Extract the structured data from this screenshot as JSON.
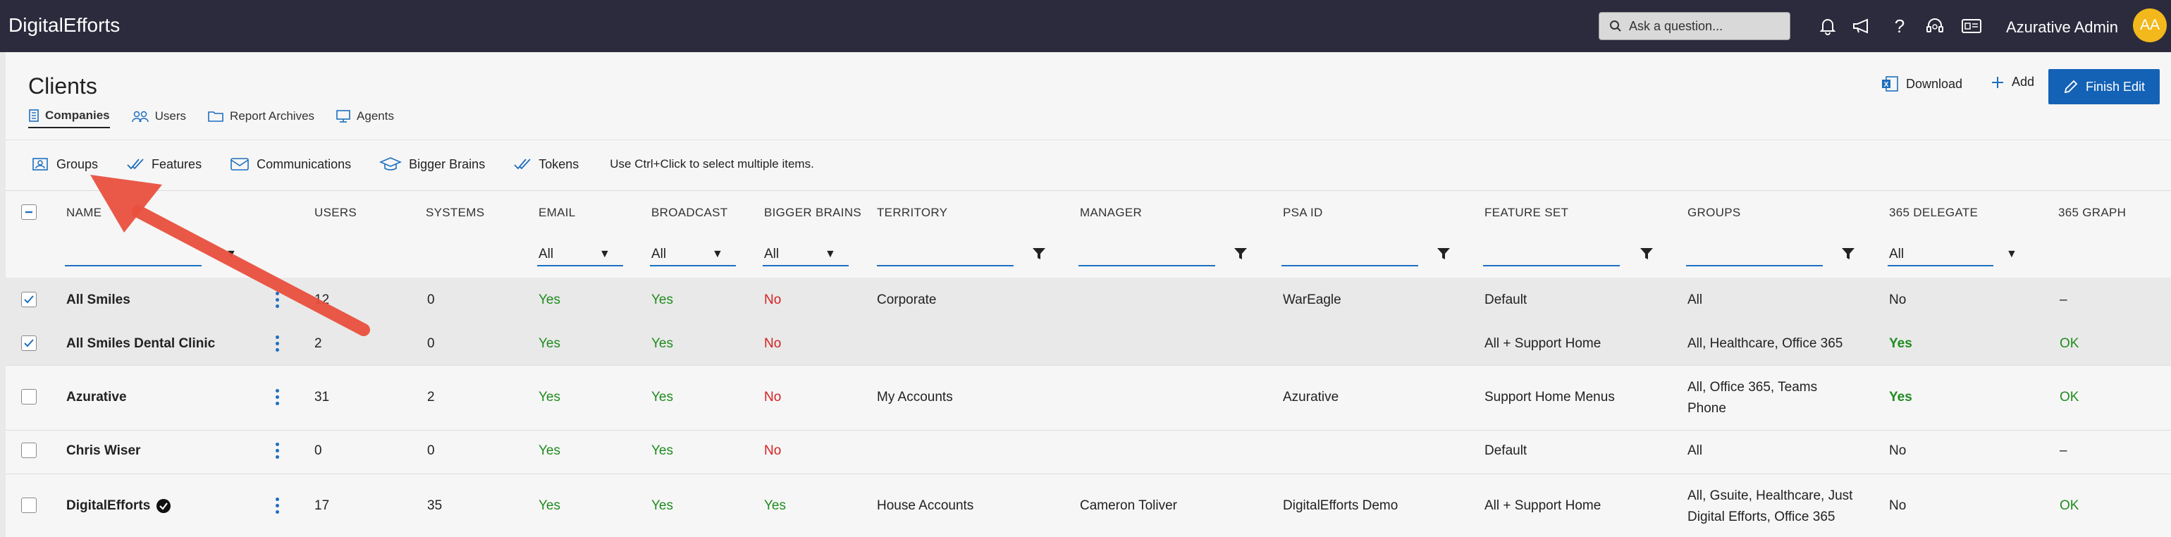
{
  "app": {
    "name": "DigitalEfforts"
  },
  "topbar": {
    "search_placeholder": "Ask a question...",
    "user_name": "Azurative Admin",
    "avatar_initials": "AA",
    "icons": [
      "bell-icon",
      "megaphone-icon",
      "help-icon",
      "headset-icon",
      "id-card-icon"
    ]
  },
  "page": {
    "title": "Clients",
    "subtabs": [
      {
        "label": "Companies",
        "icon": "building-icon",
        "active": true
      },
      {
        "label": "Users",
        "icon": "users-icon",
        "active": false
      },
      {
        "label": "Report Archives",
        "icon": "folder-icon",
        "active": false
      },
      {
        "label": "Agents",
        "icon": "monitor-icon",
        "active": false
      }
    ],
    "actions": {
      "download": "Download",
      "add": "Add",
      "finish_edit": "Finish Edit"
    }
  },
  "toolbar": {
    "items": [
      {
        "label": "Groups",
        "icon": "groups-icon"
      },
      {
        "label": "Features",
        "icon": "double-check-icon"
      },
      {
        "label": "Communications",
        "icon": "envelope-icon"
      },
      {
        "label": "Bigger Brains",
        "icon": "graduation-cap-icon"
      },
      {
        "label": "Tokens",
        "icon": "double-check-icon"
      }
    ],
    "hint": "Use Ctrl+Click to select multiple items."
  },
  "table": {
    "columns": [
      "NAME",
      "USERS",
      "SYSTEMS",
      "EMAIL",
      "BROADCAST",
      "BIGGER BRAINS",
      "TERRITORY",
      "MANAGER",
      "PSA ID",
      "FEATURE SET",
      "GROUPS",
      "365 DELEGATE",
      "365 GRAPH"
    ],
    "filters": {
      "email": "All",
      "broadcast": "All",
      "bigger_brains": "All",
      "delegate": "All"
    },
    "rows": [
      {
        "selected": true,
        "name": "All Smiles",
        "verified": false,
        "users": "12",
        "systems": "0",
        "email": "Yes",
        "broadcast": "Yes",
        "bigger_brains": "No",
        "territory": "Corporate",
        "manager": "",
        "psa_id": "WarEagle",
        "feature_set": "Default",
        "groups": "All",
        "groups2": "",
        "delegate": "No",
        "graph": "–"
      },
      {
        "selected": true,
        "name": "All Smiles Dental Clinic",
        "verified": false,
        "users": "2",
        "systems": "0",
        "email": "Yes",
        "broadcast": "Yes",
        "bigger_brains": "No",
        "territory": "",
        "manager": "",
        "psa_id": "",
        "feature_set": "All + Support Home",
        "groups": "All, Healthcare, Office 365",
        "groups2": "",
        "delegate": "Yes",
        "graph": "OK"
      },
      {
        "selected": false,
        "name": "Azurative",
        "verified": false,
        "users": "31",
        "systems": "2",
        "email": "Yes",
        "broadcast": "Yes",
        "bigger_brains": "No",
        "territory": "My Accounts",
        "manager": "",
        "psa_id": "Azurative",
        "feature_set": "Support Home Menus",
        "groups": "All, Office 365, Teams",
        "groups2": "Phone",
        "delegate": "Yes",
        "graph": "OK"
      },
      {
        "selected": false,
        "name": "Chris Wiser",
        "verified": false,
        "users": "0",
        "systems": "0",
        "email": "Yes",
        "broadcast": "Yes",
        "bigger_brains": "No",
        "territory": "",
        "manager": "",
        "psa_id": "",
        "feature_set": "Default",
        "groups": "All",
        "groups2": "",
        "delegate": "No",
        "graph": "–"
      },
      {
        "selected": false,
        "name": "DigitalEfforts",
        "verified": true,
        "users": "17",
        "systems": "35",
        "email": "Yes",
        "broadcast": "Yes",
        "bigger_brains": "Yes",
        "territory": "House Accounts",
        "manager": "Cameron Toliver",
        "psa_id": "DigitalEfforts Demo",
        "feature_set": "All + Support Home",
        "groups": "All, Gsuite, Healthcare, Just",
        "groups2": "Digital Efforts, Office 365",
        "delegate": "No",
        "graph": "OK"
      }
    ]
  },
  "colors": {
    "topbar": "#2b2b3d",
    "accent": "#1462b6",
    "yes": "#1f8c1f",
    "no": "#d62020",
    "avatar": "#f2b81c",
    "arrow": "#e9503e"
  }
}
